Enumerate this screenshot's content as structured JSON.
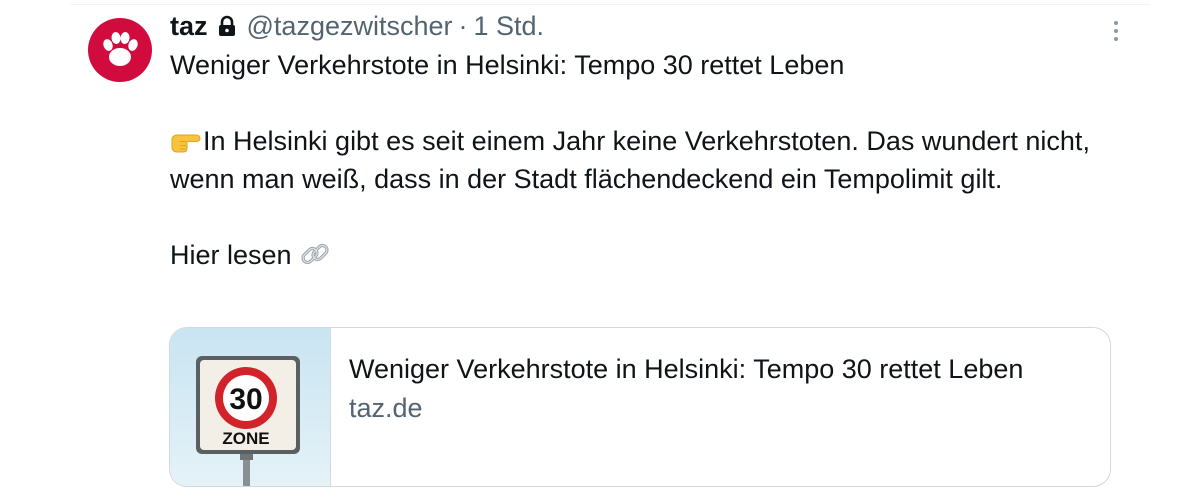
{
  "tweet": {
    "author_name": "taz",
    "handle": "@tazgezwitscher",
    "separator": "·",
    "time": "1 Std.",
    "paragraphs": {
      "line1": "Weniger Verkehrstote in Helsinki: Tempo 30 rettet Leben",
      "body": "In Helsinki gibt es seit einem Jahr keine Verkehrstoten. Das wundert nicht, wenn man weiß, dass in der Stadt flächendeckend ein Tempolimit gilt.",
      "read_here": "Hier lesen"
    },
    "icons": {
      "lock": "lock-icon",
      "point": "backhand-index-pointing-right-icon",
      "link": "link-icon",
      "more": "more-vertical-icon",
      "avatar": "paw-icon"
    }
  },
  "card": {
    "title": "Weniger Verkehrstote in Helsinki: Tempo 30 rettet Leben",
    "domain": "taz.de",
    "sign": {
      "number": "30",
      "label": "ZONE"
    }
  },
  "colors": {
    "brand": "#d10b3d",
    "text": "#0f1419",
    "muted": "#536471",
    "border": "#cfd9de"
  }
}
